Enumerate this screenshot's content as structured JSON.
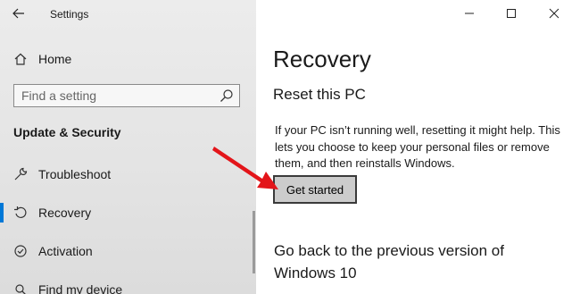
{
  "window": {
    "app_title": "Settings",
    "controls": {
      "minimize": "minimize-icon",
      "maximize": "maximize-icon",
      "close": "close-icon"
    }
  },
  "sidebar": {
    "home_label": "Home",
    "search": {
      "placeholder": "Find a setting",
      "value": ""
    },
    "section_heading": "Update & Security",
    "items": [
      {
        "label": "Troubleshoot",
        "icon": "wrench-icon",
        "active": false
      },
      {
        "label": "Recovery",
        "icon": "recovery-icon",
        "active": true
      },
      {
        "label": "Activation",
        "icon": "activation-icon",
        "active": false
      },
      {
        "label": "Find my device",
        "icon": "find-device-icon",
        "active": false
      }
    ]
  },
  "main": {
    "page_title": "Recovery",
    "reset_section": {
      "title": "Reset this PC",
      "description": "If your PC isn’t running well, resetting it might help. This lets you choose to keep your personal files or remove them, and then reinstalls Windows.",
      "button_label": "Get started"
    },
    "go_back_section": {
      "title": "Go back to the previous version of Windows 10"
    }
  },
  "colors": {
    "accent": "#0078d7",
    "annotation_arrow": "#e3151a",
    "sidebar_bg": "#e6e6e6",
    "button_bg": "#cccccc"
  }
}
